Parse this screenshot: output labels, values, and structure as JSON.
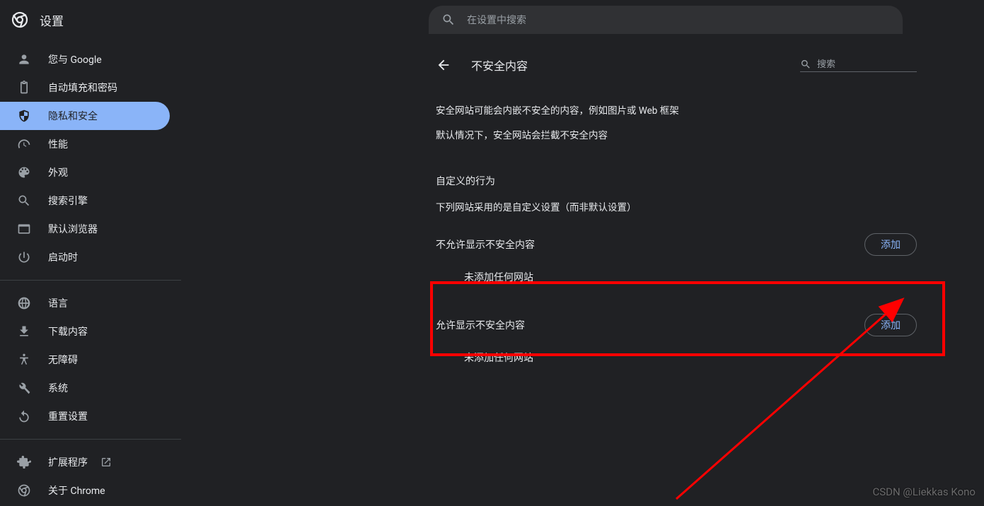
{
  "header": {
    "title": "设置",
    "search_placeholder": "在设置中搜索"
  },
  "sidebar": {
    "items": [
      {
        "icon": "person",
        "label": "您与 Google"
      },
      {
        "icon": "autofill",
        "label": "自动填充和密码"
      },
      {
        "icon": "shield",
        "label": "隐私和安全",
        "active": true
      },
      {
        "icon": "speed",
        "label": "性能"
      },
      {
        "icon": "palette",
        "label": "外观"
      },
      {
        "icon": "search",
        "label": "搜索引擎"
      },
      {
        "icon": "browser",
        "label": "默认浏览器"
      },
      {
        "icon": "power",
        "label": "启动时"
      }
    ],
    "items2": [
      {
        "icon": "globe",
        "label": "语言"
      },
      {
        "icon": "download",
        "label": "下载内容"
      },
      {
        "icon": "accessibility",
        "label": "无障碍"
      },
      {
        "icon": "wrench",
        "label": "系统"
      },
      {
        "icon": "reset",
        "label": "重置设置"
      }
    ],
    "items3": [
      {
        "icon": "extension",
        "label": "扩展程序",
        "external": true
      },
      {
        "icon": "chrome",
        "label": "关于 Chrome"
      }
    ]
  },
  "page": {
    "title": "不安全内容",
    "search_placeholder": "搜索",
    "desc_line1": "安全网站可能会内嵌不安全的内容，例如图片或 Web 框架",
    "desc_line2": "默认情况下，安全网站会拦截不安全内容",
    "custom_behavior": "自定义的行为",
    "custom_behavior_sub": "下列网站采用的是自定义设置（而非默认设置）",
    "block_label": "不允许显示不安全内容",
    "allow_label": "允许显示不安全内容",
    "empty_text": "未添加任何网站",
    "add_button": "添加"
  },
  "watermark": "CSDN @Liekkas Kono"
}
